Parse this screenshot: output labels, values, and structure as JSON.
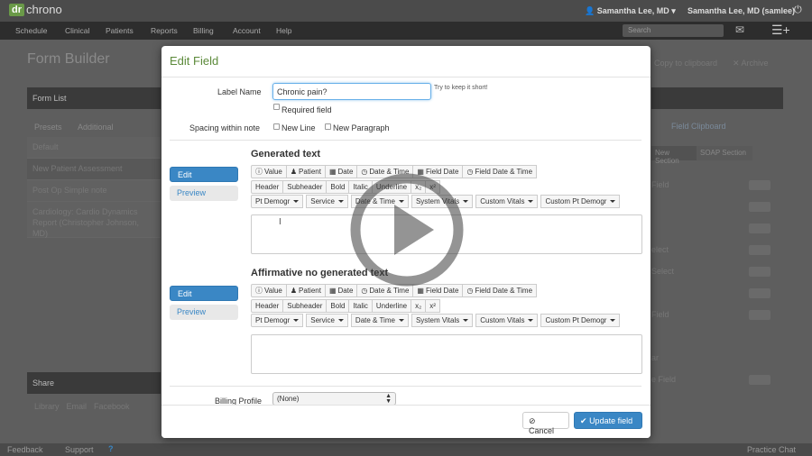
{
  "app": {
    "logo_mark": "dr",
    "logo_text": "chrono"
  },
  "topbar": {
    "user_primary": "Samantha Lee, MD",
    "user_secondary": "Samantha Lee, MD (samlee)"
  },
  "nav": {
    "items": [
      "Schedule",
      "Clinical",
      "Patients",
      "Reports",
      "Billing",
      "Account",
      "Help"
    ],
    "search_placeholder": "Search"
  },
  "background": {
    "page_title": "Form Builder",
    "copy_label": "Copy to clipboard",
    "archive_label": "Archive",
    "form_list_title": "Form List",
    "tabs": [
      "Presets",
      "Additional"
    ],
    "forms": [
      "Default",
      "New Patient Assessment",
      "Post Op Simple note",
      "Cardiology: Cardio Dynamics Report (Christopher Johnson, MD)"
    ],
    "share_title": "Share",
    "share_links": [
      "Library",
      "Email",
      "Facebook"
    ],
    "right_tab": "Field Clipboard",
    "right_btn1": "New Section",
    "right_btn2": "SOAP Section",
    "right_items": [
      "Field",
      "elect",
      "Select",
      "Field",
      "ar",
      "e Field"
    ],
    "footer_links": [
      "Feedback",
      "Support"
    ],
    "footer_right": "Practice Chat"
  },
  "modal": {
    "title": "Edit Field",
    "label_field_label": "Label Name",
    "label_value": "Chronic pain?",
    "label_hint": "Try to keep it short!",
    "required_label": "Required field",
    "spacing_label": "Spacing within note",
    "new_line_label": "New Line",
    "new_paragraph_label": "New Paragraph",
    "sections": [
      {
        "title": "Generated text",
        "edit_label": "Edit",
        "preview_label": "Preview",
        "row1": [
          "Value",
          "Patient",
          "Date",
          "Date & Time",
          "Field Date",
          "Field Date & Time"
        ],
        "row2": [
          "Header",
          "Subheader",
          "Bold",
          "Italic",
          "Underline",
          "x₂",
          "x²"
        ],
        "row3": [
          "Pt Demogr",
          "Service",
          "Date & Time",
          "System Vitals",
          "Custom Vitals",
          "Custom Pt Demogr"
        ]
      },
      {
        "title": "Affirmative no generated text",
        "edit_label": "Edit",
        "preview_label": "Preview",
        "row1": [
          "Value",
          "Patient",
          "Date",
          "Date & Time",
          "Field Date",
          "Field Date & Time"
        ],
        "row2": [
          "Header",
          "Subheader",
          "Bold",
          "Italic",
          "Underline",
          "x₂",
          "x²"
        ],
        "row3": [
          "Pt Demogr",
          "Service",
          "Date & Time",
          "System Vitals",
          "Custom Vitals",
          "Custom Pt Demogr"
        ]
      }
    ],
    "billing_label": "Billing Profile",
    "billing_value": "(None)",
    "cancel_label": "Cancel",
    "update_label": "Update field"
  },
  "icons": {
    "row1": [
      "info-icon",
      "user-icon",
      "calendar-icon",
      "clock-icon",
      "calendar-icon",
      "clock-icon"
    ],
    "cancel": "ban-icon",
    "update": "check-icon",
    "video": "play-icon"
  },
  "colors": {
    "accent": "#3a87c5",
    "title_green": "#5c8a3a",
    "overlay": "#5e5e5e"
  }
}
